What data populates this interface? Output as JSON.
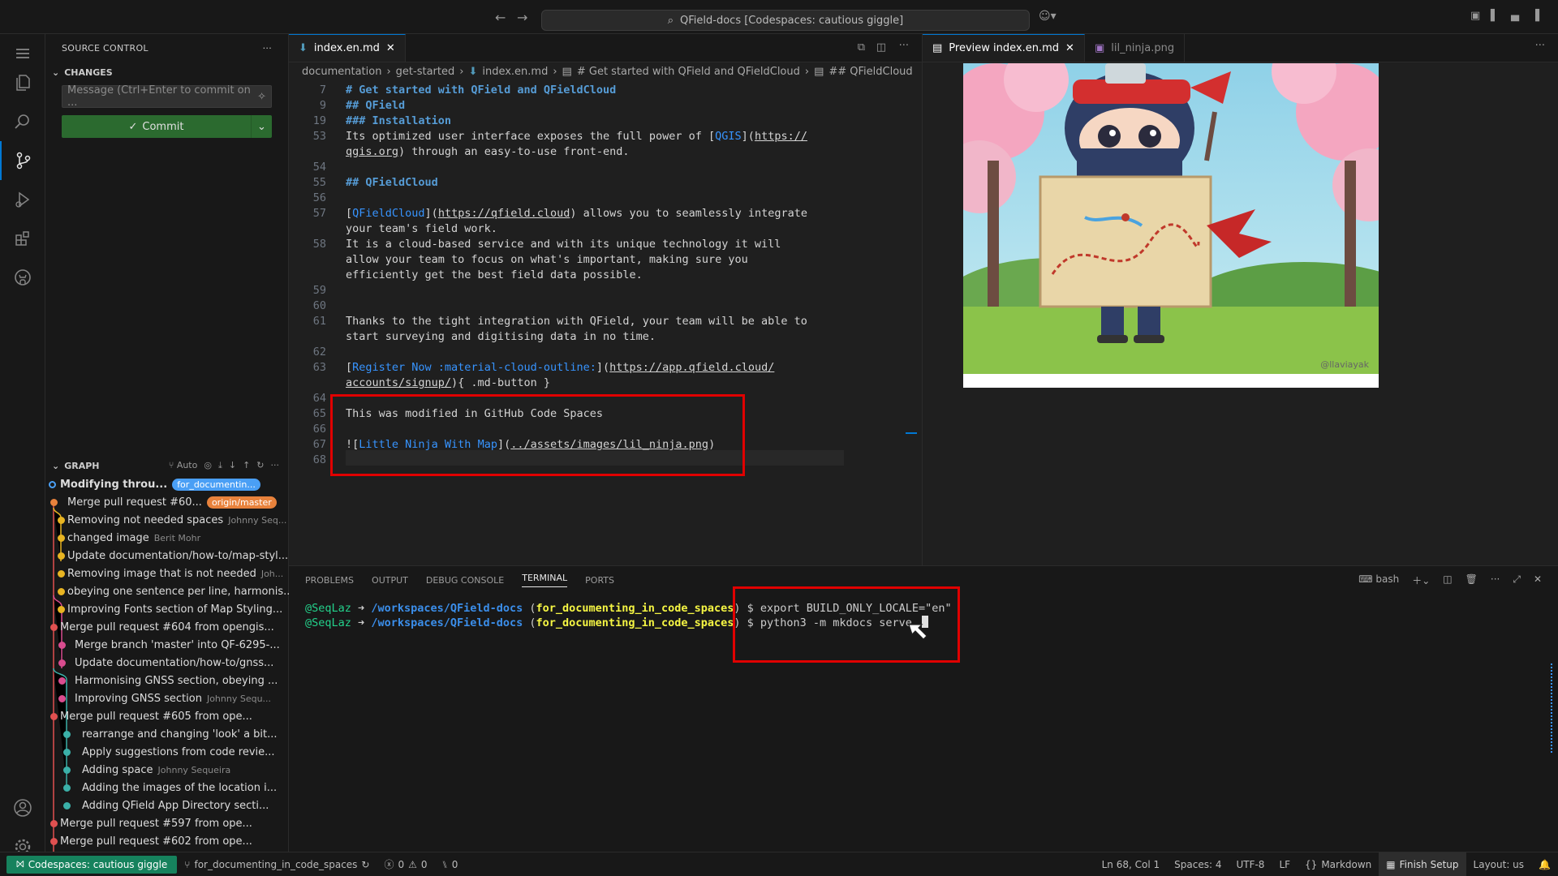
{
  "titlebar": {
    "command_center": "QField-docs [Codespaces: cautious giggle]"
  },
  "sidebar": {
    "title": "SOURCE CONTROL",
    "changes_label": "CHANGES",
    "message_placeholder": "Message (Ctrl+Enter to commit on ...",
    "commit_label": "Commit",
    "graph_label": "GRAPH",
    "graph_auto": "Auto",
    "graph": [
      {
        "msg": "Modifying throu...",
        "badge": "for_documentin...",
        "color": "#4a9ff5"
      },
      {
        "msg": "Merge pull request #60...",
        "badge": "origin/master",
        "color": "#e8823c"
      },
      {
        "msg": "Removing not needed spaces",
        "author": "Johnny Seq...",
        "color": "#e8b422"
      },
      {
        "msg": "changed image",
        "author": "Berit Mohr",
        "color": "#e8b422"
      },
      {
        "msg": "Update documentation/how-to/map-styl...",
        "color": "#e8b422"
      },
      {
        "msg": "Removing image that is not needed",
        "author": "Joh...",
        "color": "#e8b422"
      },
      {
        "msg": "obeying one sentence per line, harmonis...",
        "color": "#e8b422"
      },
      {
        "msg": "Improving Fonts section of Map Styling...",
        "color": "#e8b422"
      },
      {
        "msg": "Merge pull request #604 from opengis...",
        "color": "#e05050"
      },
      {
        "msg": "Merge branch 'master' into QF-6295-...",
        "color": "#d94c8f"
      },
      {
        "msg": "Update documentation/how-to/gnss...",
        "color": "#d94c8f"
      },
      {
        "msg": "Harmonising GNSS section, obeying ...",
        "color": "#d94c8f"
      },
      {
        "msg": "Improving GNSS section",
        "author": "Johnny Sequ...",
        "color": "#d94c8f"
      },
      {
        "msg": "Merge pull request #605 from ope...",
        "color": "#e05050"
      },
      {
        "msg": "rearrange and changing 'look' a bit...",
        "color": "#3bb0a8"
      },
      {
        "msg": "Apply suggestions from code revie...",
        "color": "#3bb0a8"
      },
      {
        "msg": "Adding space",
        "author": "Johnny Sequeira",
        "color": "#3bb0a8"
      },
      {
        "msg": "Adding the images of the location i...",
        "color": "#3bb0a8"
      },
      {
        "msg": "Adding QField App Directory secti...",
        "color": "#3bb0a8"
      },
      {
        "msg": "Merge pull request #597 from ope...",
        "color": "#e05050"
      },
      {
        "msg": "Merge pull request #602 from ope...",
        "color": "#e05050"
      }
    ]
  },
  "editor": {
    "tab": "index.en.md",
    "crumbs": [
      "documentation",
      "get-started",
      "index.en.md",
      "# Get started with QField and QFieldCloud",
      "## QFieldCloud"
    ],
    "lines": [
      {
        "n": "7",
        "segs": [
          {
            "c": "h",
            "t": "# Get started with QField and QFieldCloud"
          }
        ]
      },
      {
        "n": "9",
        "segs": [
          {
            "c": "h",
            "t": "## QField"
          }
        ]
      },
      {
        "n": "19",
        "segs": [
          {
            "c": "h",
            "t": "### Installation"
          }
        ]
      },
      {
        "n": "53",
        "segs": [
          {
            "c": "",
            "t": "Its optimized user interface exposes the full power of ["
          },
          {
            "c": "lk",
            "t": "QGIS"
          },
          {
            "c": "",
            "t": "]("
          },
          {
            "c": "u",
            "t": "https://"
          }
        ]
      },
      {
        "n": "",
        "segs": [
          {
            "c": "u",
            "t": "qgis.org"
          },
          {
            "c": "",
            "t": ") through an easy-to-use front-end."
          }
        ]
      },
      {
        "n": "54",
        "segs": []
      },
      {
        "n": "55",
        "segs": [
          {
            "c": "h",
            "t": "## QFieldCloud"
          }
        ]
      },
      {
        "n": "56",
        "segs": []
      },
      {
        "n": "57",
        "segs": [
          {
            "c": "",
            "t": "["
          },
          {
            "c": "lk",
            "t": "QFieldCloud"
          },
          {
            "c": "",
            "t": "]("
          },
          {
            "c": "u",
            "t": "https://qfield.cloud"
          },
          {
            "c": "",
            "t": ") allows you to seamlessly integrate"
          }
        ]
      },
      {
        "n": "",
        "segs": [
          {
            "c": "",
            "t": "your team's field work."
          }
        ]
      },
      {
        "n": "58",
        "segs": [
          {
            "c": "",
            "t": "It is a cloud-based service and with its unique technology it will"
          }
        ]
      },
      {
        "n": "",
        "segs": [
          {
            "c": "",
            "t": "allow your team to focus on what's important, making sure you"
          }
        ]
      },
      {
        "n": "",
        "segs": [
          {
            "c": "",
            "t": "efficiently get the best field data possible."
          }
        ]
      },
      {
        "n": "59",
        "segs": []
      },
      {
        "n": "60",
        "segs": []
      },
      {
        "n": "61",
        "segs": [
          {
            "c": "",
            "t": "Thanks to the tight integration with QField, your team will be able to"
          }
        ]
      },
      {
        "n": "",
        "segs": [
          {
            "c": "",
            "t": "start surveying and digitising data in no time."
          }
        ]
      },
      {
        "n": "62",
        "segs": []
      },
      {
        "n": "63",
        "segs": [
          {
            "c": "",
            "t": "["
          },
          {
            "c": "lk",
            "t": "Register Now :material-cloud-outline:"
          },
          {
            "c": "",
            "t": "]("
          },
          {
            "c": "u",
            "t": "https://app.qfield.cloud/"
          }
        ]
      },
      {
        "n": "",
        "segs": [
          {
            "c": "u",
            "t": "accounts/signup/"
          },
          {
            "c": "",
            "t": "){ .md-button }"
          }
        ]
      },
      {
        "n": "64",
        "segs": []
      },
      {
        "n": "65",
        "segs": [
          {
            "c": "",
            "t": "This was modified in GitHub Code Spaces"
          }
        ]
      },
      {
        "n": "66",
        "segs": []
      },
      {
        "n": "67",
        "segs": [
          {
            "c": "",
            "t": "!["
          },
          {
            "c": "lk",
            "t": "Little Ninja With Map"
          },
          {
            "c": "",
            "t": "]("
          },
          {
            "c": "u",
            "t": "../assets/images/lil_ninja.png"
          },
          {
            "c": "",
            "t": ")"
          }
        ]
      },
      {
        "n": "68",
        "segs": []
      }
    ]
  },
  "preview": {
    "tab1": "Preview index.en.md",
    "tab2": "lil_ninja.png",
    "watermark": "@llaviayak"
  },
  "panel": {
    "tabs": [
      "PROBLEMS",
      "OUTPUT",
      "DEBUG CONSOLE",
      "TERMINAL",
      "PORTS"
    ],
    "shell": "bash",
    "terminal": [
      {
        "user": "@SeqLaz",
        "arrow": "➜",
        "path": "/workspaces/QField-docs",
        "branch": "for_documenting_in_code_spaces",
        "cmd": "$ export BUILD_ONLY_LOCALE=\"en\""
      },
      {
        "user": "@SeqLaz",
        "arrow": "➜",
        "path": "/workspaces/QField-docs",
        "branch": "for_documenting_in_code_spaces",
        "cmd": "$ python3 -m mkdocs serve"
      }
    ]
  },
  "statusbar": {
    "remote": "Codespaces: cautious giggle",
    "branch": "for_documenting_in_code_spaces",
    "problems": "0",
    "warnings": "0",
    "ports": "0",
    "position": "Ln 68, Col 1",
    "spaces": "Spaces: 4",
    "encoding": "UTF-8",
    "eol": "LF",
    "language": "Markdown",
    "setup": "Finish Setup",
    "layout": "Layout: us"
  }
}
